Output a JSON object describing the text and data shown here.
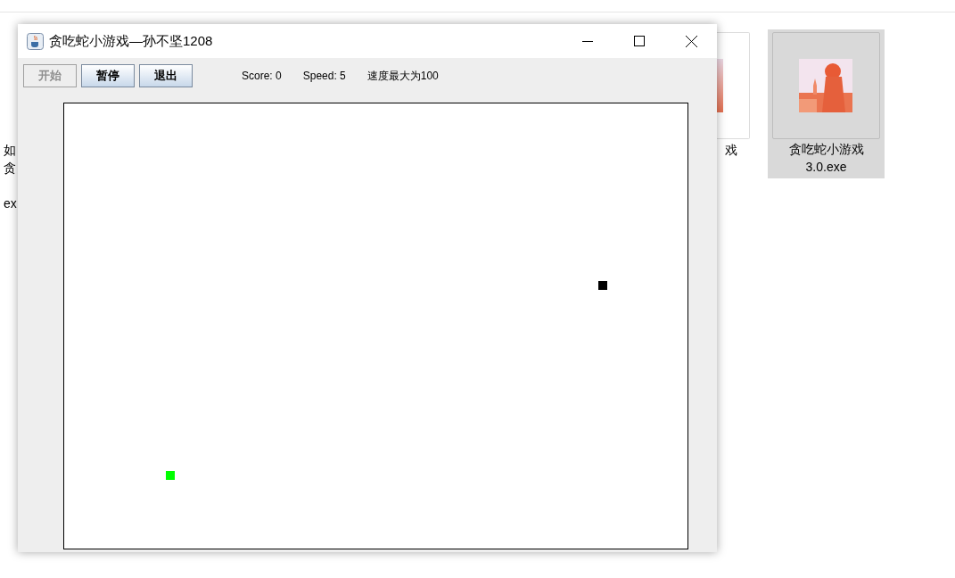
{
  "window": {
    "title": "贪吃蛇小游戏—孙不坚1208"
  },
  "buttons": [
    {
      "label": "开始",
      "disabled": true
    },
    {
      "label": "暂停",
      "disabled": false
    },
    {
      "label": "退出",
      "disabled": false
    }
  ],
  "status": [
    "Score: 0",
    "Speed: 5",
    "速度最大为100"
  ],
  "desktop_icons": [
    {
      "label_lines": [
        "如",
        "贪",
        "ex"
      ],
      "selected": false
    },
    {
      "label_lines": [
        "戏"
      ],
      "selected": false
    },
    {
      "label_lines": [
        "贪吃蛇小游戏",
        "3.0.exe"
      ],
      "selected": true
    }
  ]
}
